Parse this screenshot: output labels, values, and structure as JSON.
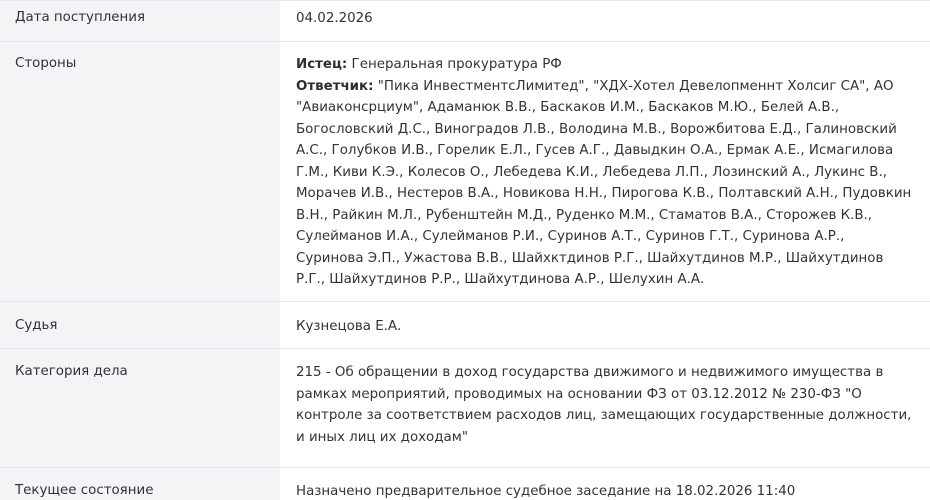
{
  "rows": {
    "date": {
      "label": "Дата поступления",
      "value": "04.02.2026"
    },
    "parties": {
      "label": "Стороны",
      "plaintiff_label": "Истец:",
      "plaintiff_value": "Генеральная прокуратура РФ",
      "defendant_label": "Ответчик:",
      "defendant_value": "\"Пика ИнвестментсЛимитед\", \"ХДХ-Хотел Девелопменнт Холсиг СА\", АО \"Авиаконсрциум\", Адаманюк В.В., Баскаков И.М., Баскаков М.Ю., Белей А.В., Богословский Д.С., Виноградов Л.В., Володина М.В., Ворожбитова Е.Д., Галиновский А.С., Голубков И.В., Горелик Е.Л., Гусев А.Г., Давыдкин О.А., Ермак А.Е., Исмагилова Г.М., Киви К.Э., Колесов О., Лебедева К.И., Лебедева Л.П., Лозинский А., Лукинс В., Морачев И.В., Нестеров В.А., Новикова Н.Н., Пирогова К.В., Полтавский А.Н., Пудовкин В.Н., Райкин М.Л., Рубенштейн М.Д., Руденко М.М., Стаматов В.А., Сторожев К.В., Сулейманов И.А., Сулейманов Р.И., Суринов А.Т., Суринов Г.Т., Суринова А.Р., Суринова Э.П., Ужастова В.В., Шайхктдинов Р.Г., Шайхутдинов М.Р., Шайхутдинов Р.Г., Шайхутдинов Р.Р., Шайхутдинова А.Р., Шелухин А.А."
    },
    "judge": {
      "label": "Судья",
      "value": "Кузнецова Е.А."
    },
    "category": {
      "label": "Категория дела",
      "value": "215 - Об обращении в доход государства движимого и недвижимого имущества в рамках мероприятий, проводимых на основании ФЗ от 03.12.2012 № 230-ФЗ \"О контроле за соответствием расходов лиц, замещающих государственные должности, и иных лиц их доходам\""
    },
    "status": {
      "label": "Текущее состояние",
      "value": "Назначено предварительное судебное заседание на 18.02.2026 11:40"
    }
  }
}
